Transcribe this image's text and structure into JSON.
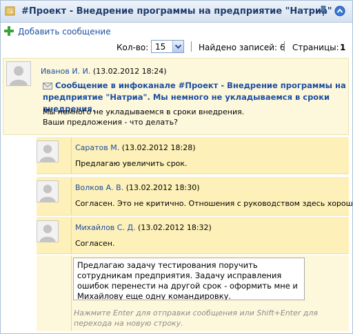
{
  "header": {
    "title": "#Проект - Внедрение программы на предприятие \"Натриа\"",
    "icons": [
      "folder-icon",
      "pin-icon",
      "collapse-icon"
    ]
  },
  "toolbar": {
    "add_label": "Добавить сообщение",
    "count_label": "Кол-во:",
    "count_value": "15",
    "found_label": "Найдено записей: 6",
    "pages_label": "Страницы:",
    "pages_current": "1"
  },
  "post": {
    "author": "Иванов И. И.",
    "time": "(13.02.2012 18:24)",
    "subject": "Сообщение в инфоканале #Проект - Внедрение программы на предприятие \"Натриа\". Мы немного не укладываемся в сроки внедрения.",
    "body_line1": "Мы немного не укладываемся в сроки внедрения.",
    "body_line2": "Ваши предложения - что делать?"
  },
  "replies": [
    {
      "author": "Саратов М.",
      "time": "(13.02.2012 18:28)",
      "text": "Предлагаю увеличить срок."
    },
    {
      "author": "Волков А. В.",
      "time": "(13.02.2012 18:30)",
      "text": "Согласен. Это не критично. Отношения с руководством здесь хорошие."
    },
    {
      "author": "Михайлов С. Д.",
      "time": "(13.02.2012 18:32)",
      "text": "Согласен."
    }
  ],
  "composer": {
    "value": "Предлагаю задачу тестирования поручить сотрудникам предприятия. Задачу исправления ошибок перенести на другой срок - оформить мне и Михайлову еще одну командировку.",
    "hint": "Нажмите Enter для отправки сообщения или Shift+Enter для перехода на новую строку."
  },
  "colors": {
    "header_title": "#1f3c6c",
    "link": "#1b4ea0",
    "post_bg": "#fdf8dc",
    "reply_bg": "#fdf0b8",
    "hint": "#8c8c8c"
  }
}
